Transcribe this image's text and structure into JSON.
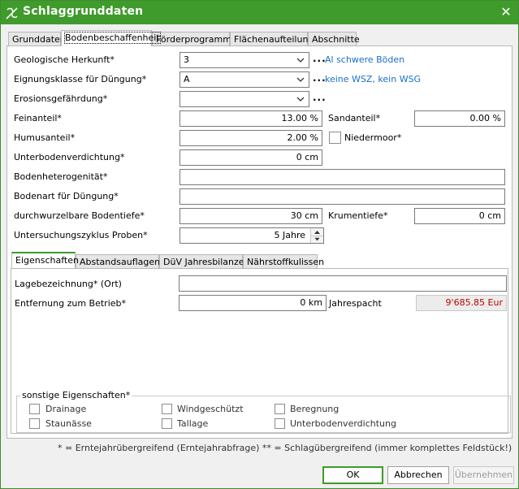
{
  "window": {
    "title": "Schlaggrunddaten",
    "icon": "plant-icon",
    "close": "✕"
  },
  "tabs": [
    "Grunddaten",
    "Bodenbeschaffenheit",
    "Förderprogramme",
    "Flächenaufteilung",
    "Abschnitte"
  ],
  "soil": {
    "herkunft_label": "Geologische Herkunft*",
    "herkunft_value": "3",
    "herkunft_link": "Al schwere Böden",
    "eignung_label": "Eignungsklasse für Düngung*",
    "eignung_value": "A",
    "eignung_link": "keine WSZ, kein WSG",
    "erosion_label": "Erosionsgefährdung*",
    "erosion_value": "",
    "dots": "...",
    "feinanteil_label": "Feinanteil*",
    "feinanteil_value": "13.00 %",
    "sandanteil_label": "Sandanteil*",
    "sandanteil_value": "0.00 %",
    "humus_label": "Humusanteil*",
    "humus_value": "2.00 %",
    "niedermoor_label": "Niedermoor*",
    "unterboden_label": "Unterbodenverdichtung*",
    "unterboden_value": "0 cm",
    "hetero_label": "Bodenheterogenität*",
    "hetero_value": "",
    "bodenart_label": "Bodenart für Düngung*",
    "bodenart_value": "",
    "wurzel_label": "durchwurzelbare Bodentiefe*",
    "wurzel_value": "30 cm",
    "krume_label": "Krumentiefe*",
    "krume_value": "0 cm",
    "zyklus_label": "Untersuchungszyklus Proben*",
    "zyklus_value": "5 Jahre"
  },
  "subtabs": [
    "Eigenschaften",
    "Abstandsauflagen*",
    "DüV Jahresbilanzen",
    "Nährstoffkulissen"
  ],
  "props": {
    "lage_label": "Lagebezeichnung* (Ort)",
    "lage_value": "",
    "entfernung_label": "Entfernung zum Betrieb*",
    "entfernung_value": "0 km",
    "pacht_label": "Jahrespacht",
    "pacht_value": "9'685.85 Eur",
    "pacht_color": "#c00000",
    "sonstige_label": "sonstige Eigenschaften*",
    "checks": [
      "Drainage",
      "Windgeschützt",
      "Beregnung",
      "Staunässe",
      "Tallage",
      "Unterbodenverdichtung"
    ]
  },
  "footnote": "* = Erntejahrübergreifend (Erntejahrabfrage)   ** = Schlagübergreifend (immer komplettes Feldstück!)",
  "buttons": {
    "ok": "OK",
    "cancel": "Abbrechen",
    "apply": "Übernehmen"
  },
  "colors": {
    "accent": "#3f9b2b",
    "link": "#1a6fc8"
  }
}
